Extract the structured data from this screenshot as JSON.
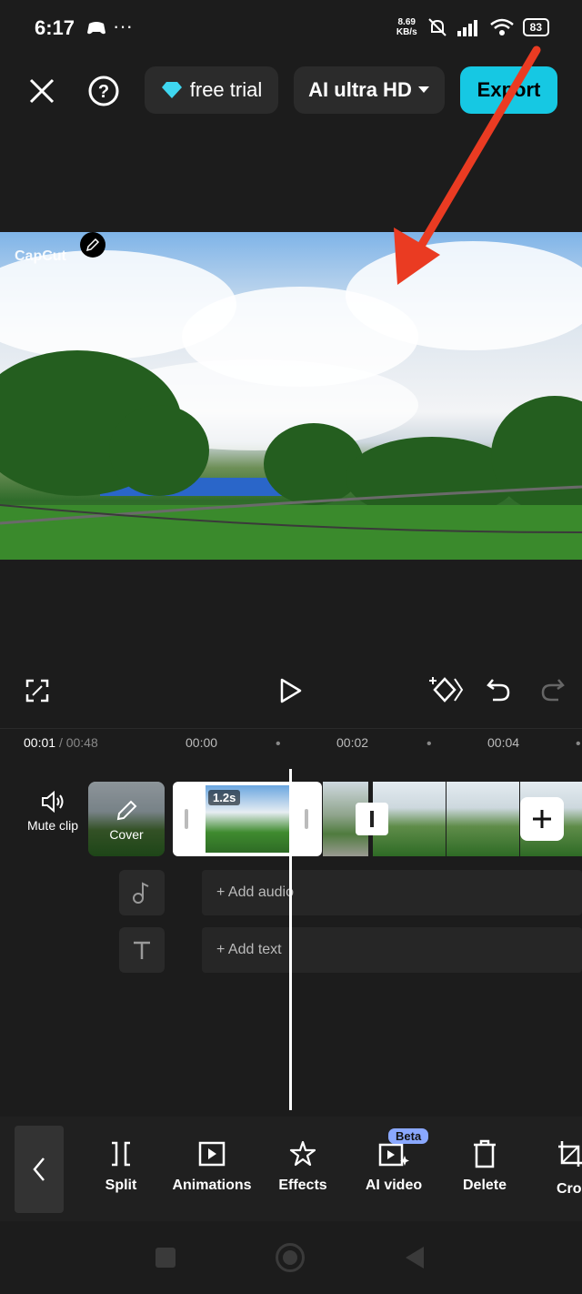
{
  "status": {
    "time": "6:17",
    "speed_value": "8.69",
    "speed_unit": "KB/s",
    "battery": "83"
  },
  "top_bar": {
    "free_trial": "free trial",
    "quality": "AI ultra HD",
    "export": "Export"
  },
  "preview": {
    "watermark": "CapCut"
  },
  "playback": {
    "current": "00:01",
    "total": "/ 00:48",
    "ticks": [
      "00:00",
      "00:02",
      "00:04"
    ]
  },
  "timeline": {
    "mute_label": "Mute clip",
    "cover_label": "Cover",
    "clip_duration": "1.2s",
    "add_audio": "+ Add audio",
    "add_text": "+ Add text"
  },
  "toolbar": {
    "items": [
      "Split",
      "Animations",
      "Effects",
      "AI video",
      "Delete",
      "Cro"
    ],
    "beta_badge": "Beta"
  },
  "colors": {
    "accent": "#16c8e3",
    "arrow": "#ea3b22",
    "beta": "#8aa8ff"
  }
}
